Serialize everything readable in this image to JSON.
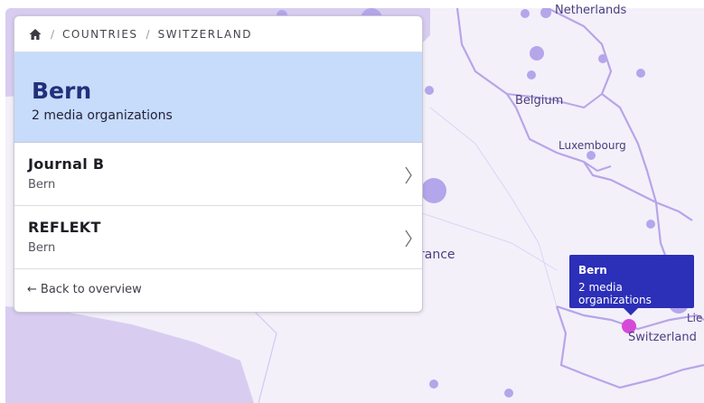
{
  "breadcrumb": {
    "home_icon": "home-icon",
    "items": [
      "COUNTRIES",
      "SWITZERLAND"
    ]
  },
  "header": {
    "title": "Bern",
    "subtitle": "2 media organizations"
  },
  "organizations": [
    {
      "name": "Journal B",
      "city": "Bern"
    },
    {
      "name": "REFLEKT",
      "city": "Bern"
    }
  ],
  "back_link": {
    "arrow": "←",
    "label": "Back to overview"
  },
  "tooltip": {
    "title": "Bern",
    "subtitle": "2 media organizations"
  },
  "map_labels": {
    "netherlands": "Netherlands",
    "belgium": "Belgium",
    "luxembourg": "Luxembourg",
    "france": "rance",
    "switzerland": "Switzerland",
    "liechtenstein": "Lie"
  },
  "colors": {
    "header_bg": "#c7dbfb",
    "title": "#21307a",
    "tooltip_bg": "#2c2fb7",
    "selected_marker": "#d64ad8",
    "map_marker": "#b4a6ea"
  }
}
